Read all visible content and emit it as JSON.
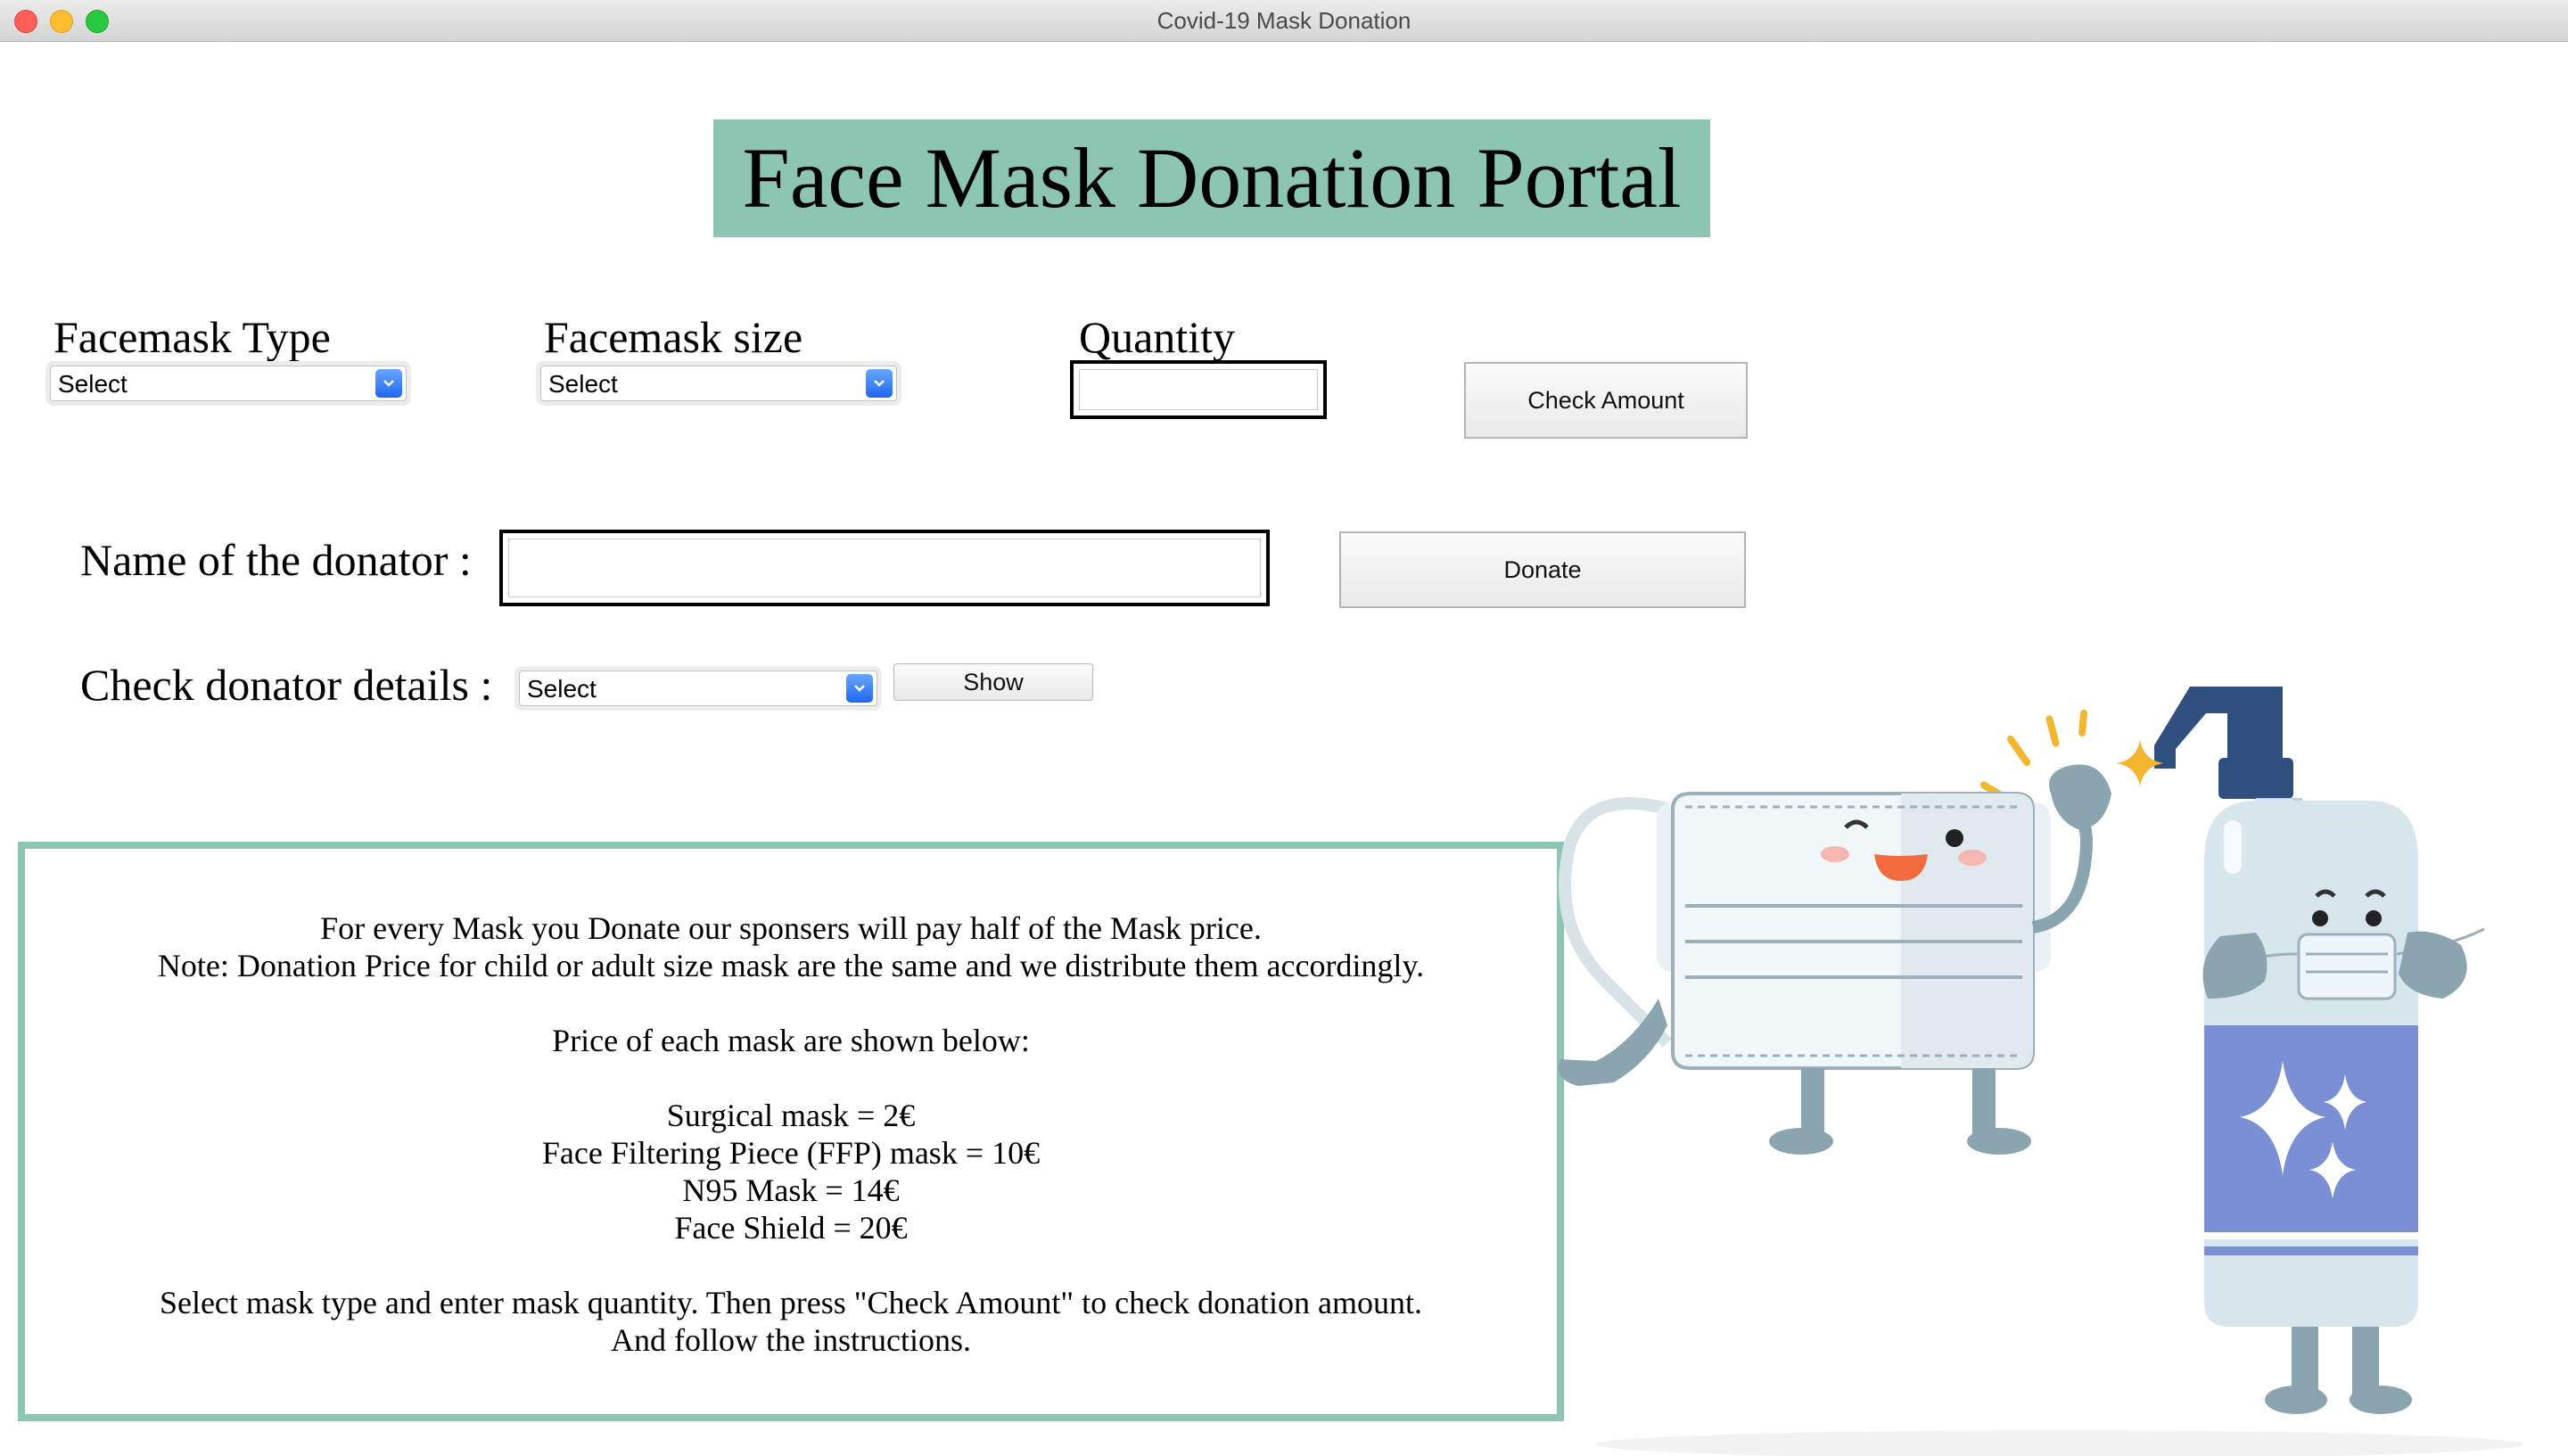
{
  "window": {
    "title": "Covid-19 Mask Donation"
  },
  "portal_title": "Face Mask Donation Portal",
  "form": {
    "mask_type": {
      "label": "Facemask Type",
      "selected": "Select"
    },
    "mask_size": {
      "label": "Facemask size",
      "selected": "Select"
    },
    "quantity": {
      "label": "Quantity",
      "value": ""
    },
    "check_amount_label": "Check Amount",
    "donator_name": {
      "label": "Name of the donator :",
      "value": ""
    },
    "donate_label": "Donate",
    "check_details": {
      "label": "Check donator details :",
      "selected": "Select"
    },
    "show_label": "Show"
  },
  "info": {
    "lines": [
      "For every Mask you Donate our sponsers will pay half of the Mask price.",
      "Note: Donation Price for child or adult size mask are the same and we distribute them accordingly.",
      "Price of each mask are shown below:",
      "Surgical mask = 2€",
      "Face Filtering Piece (FFP) mask = 10€",
      "N95 Mask = 14€",
      "Face Shield = 20€",
      "Select mask type and enter mask quantity. Then press \"Check Amount\" to check donation amount.",
      "And follow the instructions."
    ]
  },
  "colors": {
    "accent": "#8cc6b3",
    "select_arrow": "#2f78f5",
    "bottle_label": "#7b8fd4",
    "bottle_pump": "#2f4f7f"
  },
  "icons": {
    "dropdown": "chevron-down-icon"
  }
}
